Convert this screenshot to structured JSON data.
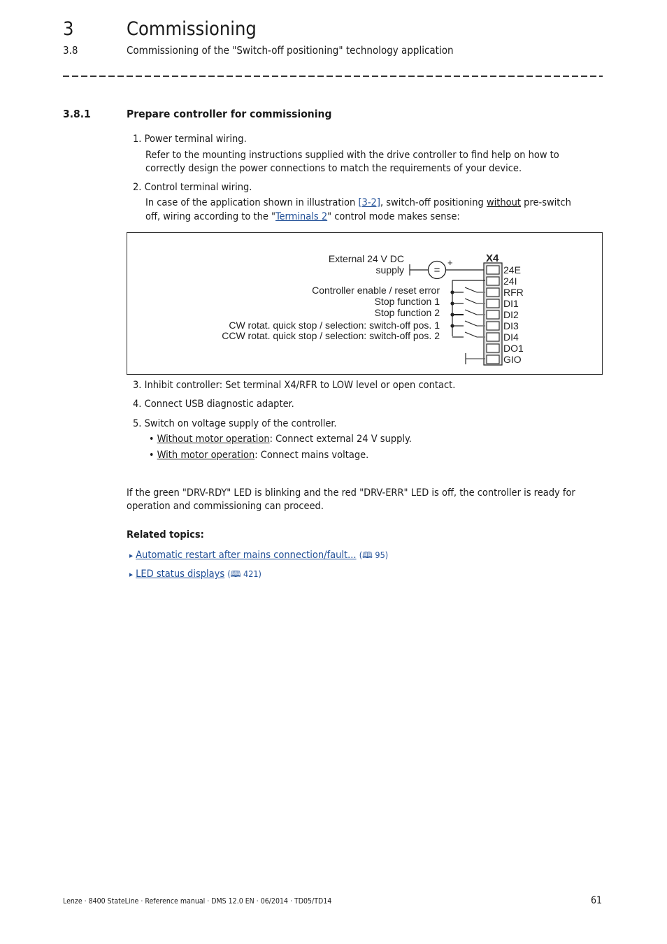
{
  "header": {
    "chapter_number": "3",
    "chapter_title": "Commissioning",
    "section_number": "3.8",
    "section_title": "Commissioning of the \"Switch-off positioning\" technology application"
  },
  "subsection": {
    "number": "3.8.1",
    "title": "Prepare controller for commissioning"
  },
  "steps": [
    {
      "num": "1.",
      "title": "Power terminal wiring.",
      "body_line1": "Refer to the mounting instructions supplied with the drive controller to find help on how to",
      "body_line2": "correctly design the power connections to match the requirements of your device."
    },
    {
      "num": "2.",
      "title": "Control terminal wiring.",
      "body_pre": "In case of the application shown in illustration ",
      "body_link": "[3-2]",
      "body_mid": ", switch-off positioning ",
      "body_ul": "without",
      "body_post": " pre-switch",
      "body_line2_pre": "off, wiring according to the \"",
      "body_line2_link": "Terminals 2",
      "body_line2_post": "\" control mode makes sense:"
    },
    {
      "num": "3.",
      "title": "Inhibit controller: Set terminal X4/RFR to LOW level or open contact."
    },
    {
      "num": "4.",
      "title": "Connect USB diagnostic adapter."
    },
    {
      "num": "5.",
      "title": "Switch on voltage supply of the controller.",
      "bullets": [
        {
          "ul": "Without motor operation",
          "rest": ": Connect external 24 V supply."
        },
        {
          "ul": "With motor operation",
          "rest": ": Connect mains voltage."
        }
      ]
    }
  ],
  "diagram": {
    "connector_label": "X4",
    "supply_label_line1": "External 24 V DC",
    "supply_label_line2": "supply",
    "source_symbol": "=",
    "plus_symbol": "+",
    "terminals": [
      "24E",
      "24I",
      "RFR",
      "DI1",
      "DI2",
      "DI3",
      "DI4",
      "DO1",
      "GIO"
    ],
    "signal_labels": [
      "Controller enable / reset error",
      "Stop function 1",
      "Stop function 2",
      "CW rotat. quick stop / selection: switch-off pos. 1",
      "CCW rotat. quick stop / selection: switch-off pos. 2"
    ]
  },
  "paragraph": {
    "line1": "If the green \"DRV-RDY\" LED is blinking and the red \"DRV-ERR\" LED is off, the controller is ready for",
    "line2": "operation and commissioning can proceed."
  },
  "related": {
    "heading": "Related topics:",
    "links": [
      {
        "label": "Automatic restart after mains connection/fault...",
        "page_ref": "95"
      },
      {
        "label": "LED status displays",
        "page_ref": "421"
      }
    ],
    "arrow_icon": "▸",
    "book_icon": "🕮"
  },
  "footer": {
    "text": "Lenze · 8400 StateLine · Reference manual · DMS 12.0 EN · 06/2014 · TD05/TD14",
    "page_number": "61"
  }
}
